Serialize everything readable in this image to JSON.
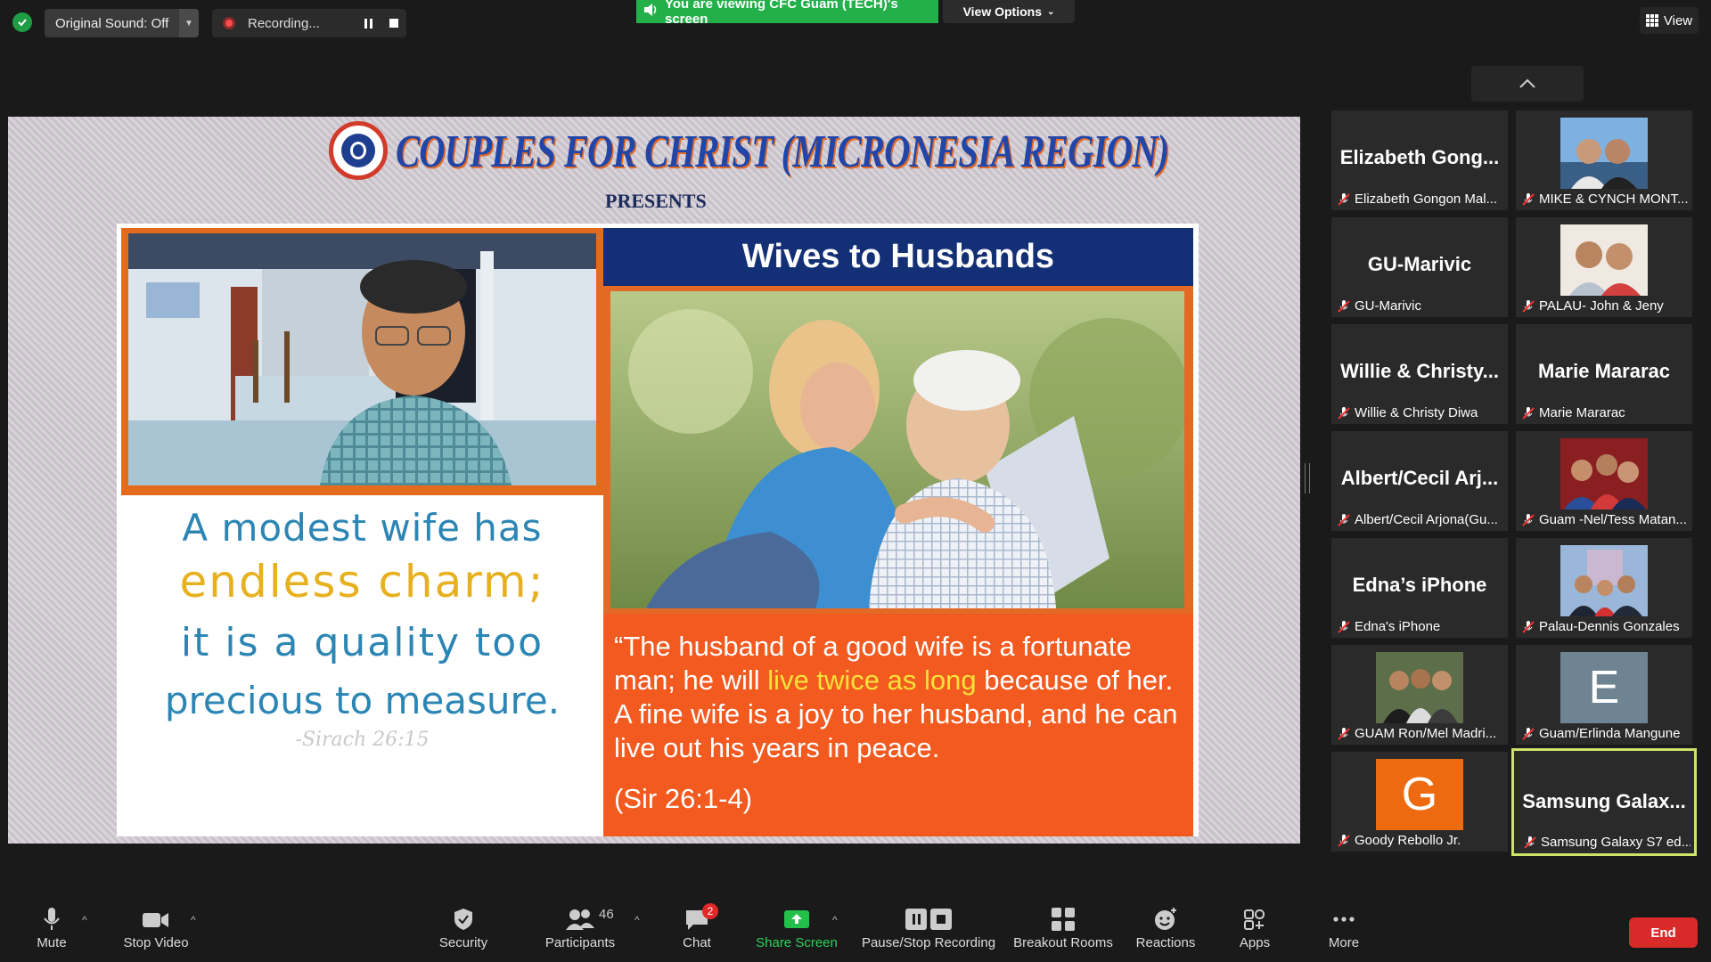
{
  "topbar": {
    "original_sound_label": "Original Sound: Off",
    "recording_label": "Recording...",
    "viewing_banner": "You are viewing CFC Guam (TECH)'s screen",
    "view_options_label": "View Options",
    "view_label": "View"
  },
  "slide": {
    "org_title": "COUPLES FOR CHRIST (MICRONESIA REGION)",
    "presents": "PRESENTS",
    "heading": "Wives to Husbands",
    "quote_line1": "A modest wife has",
    "quote_line2": "endless charm;",
    "quote_line3": "it is a quality too",
    "quote_line4": "precious to measure.",
    "quote_ref": "-Sirach 26:15",
    "verse_part1": "“The husband of a good wife is a fortunate man; he will ",
    "verse_highlight": "live twice as long",
    "verse_part2": " because of her. A fine wife is a joy to her husband, and he can live out his years in peace.",
    "verse_ref": "(Sir 26:1-4)"
  },
  "gallery": [
    {
      "big": "Elizabeth Gong...",
      "label": "Elizabeth Gongon Mal..."
    },
    {
      "big": "",
      "label": "MIKE & CYNCH MONT..."
    },
    {
      "big": "GU-Marivic",
      "label": "GU-Marivic"
    },
    {
      "big": "",
      "label": "PALAU- John & Jeny"
    },
    {
      "big": "Willie & Christy...",
      "label": "Willie & Christy Diwa"
    },
    {
      "big": "Marie Mararac",
      "label": "Marie Mararac"
    },
    {
      "big": "Albert/Cecil Arj...",
      "label": "Albert/Cecil Arjona(Gu..."
    },
    {
      "big": "",
      "label": "Guam -Nel/Tess Matan..."
    },
    {
      "big": "Edna’s iPhone",
      "label": "Edna's iPhone"
    },
    {
      "big": "",
      "label": "Palau-Dennis Gonzales"
    },
    {
      "big": "",
      "label": "GUAM Ron/Mel Madri..."
    },
    {
      "big": "E",
      "label": "Guam/Erlinda Mangune"
    },
    {
      "big": "G",
      "label": "Goody Rebollo Jr."
    },
    {
      "big": "Samsung Galax...",
      "label": "Samsung Galaxy S7 ed..."
    }
  ],
  "toolbar": {
    "mute": "Mute",
    "stop_video": "Stop Video",
    "security": "Security",
    "participants": "Participants",
    "participants_count": "46",
    "chat": "Chat",
    "chat_badge": "2",
    "share_screen": "Share Screen",
    "pause_stop_recording": "Pause/Stop Recording",
    "breakout_rooms": "Breakout Rooms",
    "reactions": "Reactions",
    "apps": "Apps",
    "more": "More",
    "end": "End"
  },
  "colors": {
    "share_green": "#23b04a",
    "end_red": "#d92a2a",
    "active_speaker_border": "#cde46a",
    "slide_orange": "#f25a20",
    "slide_navy": "#132f75"
  }
}
